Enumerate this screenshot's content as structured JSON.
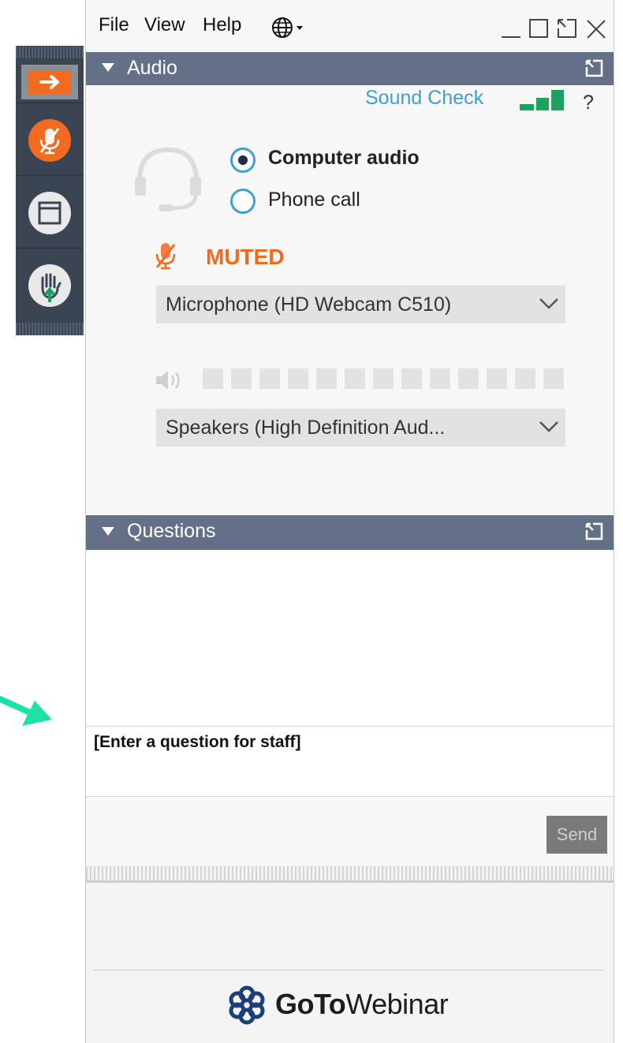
{
  "menu": {
    "file": "File",
    "view": "View",
    "help": "Help",
    "language_icon": "globe-icon"
  },
  "window_controls": {
    "minimize": "minimize-icon",
    "maximize": "maximize-icon",
    "popout": "popout-icon",
    "close": "close-icon"
  },
  "audio_panel": {
    "title": "Audio",
    "sound_check": "Sound Check",
    "help": "?",
    "options": [
      {
        "label": "Computer audio",
        "selected": true
      },
      {
        "label": "Phone call",
        "selected": false
      }
    ],
    "mute_status": "MUTED",
    "microphone": "Microphone (HD Webcam C510)",
    "speakers": "Speakers (High  Definition  Aud...",
    "speaker_level_segments": 13,
    "speaker_level_active": 0
  },
  "questions_panel": {
    "title": "Questions",
    "input_placeholder": "[Enter a question for staff]",
    "send": "Send"
  },
  "brand": {
    "goto": "GoTo",
    "webinar": "Webinar"
  },
  "toolbar": {
    "items": [
      "expand-arrow-icon",
      "microphone-muted-icon",
      "screen-icon",
      "raise-hand-icon"
    ]
  },
  "colors": {
    "accent_orange": "#f06a1e",
    "panel_header": "#637088",
    "link_blue": "#3d9fd6",
    "signal_green": "#1aa260",
    "annotation_arrow": "#1ee1a8"
  }
}
